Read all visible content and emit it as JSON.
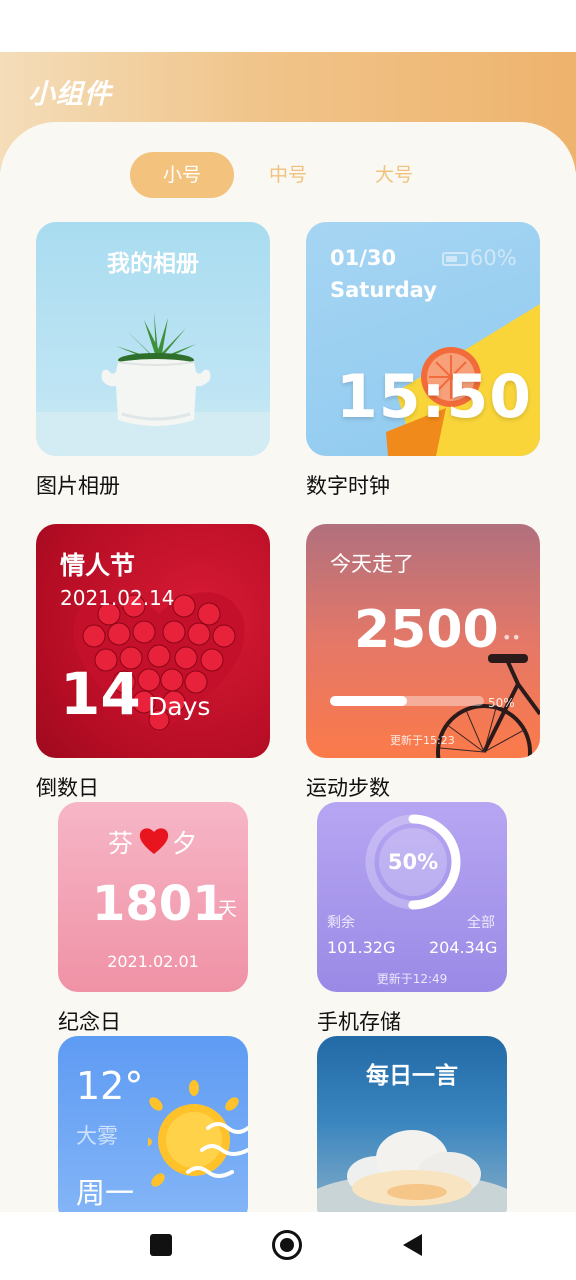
{
  "header": {
    "title": "小组件"
  },
  "tabs": [
    {
      "label": "小号",
      "active": true
    },
    {
      "label": "中号",
      "active": false
    },
    {
      "label": "大号",
      "active": false
    }
  ],
  "widgets": {
    "album": {
      "card_title": "我的相册",
      "caption": "图片相册"
    },
    "clock": {
      "date": "01/30",
      "weekday": "Saturday",
      "battery": "60%",
      "battery_level": 0.6,
      "time": "15:50",
      "caption": "数字时钟"
    },
    "countdown": {
      "event": "情人节",
      "date": "2021.02.14",
      "count": "14",
      "unit": "Days",
      "caption": "倒数日"
    },
    "steps": {
      "label": "今天走了",
      "count": "2500",
      "progress": "50%",
      "progress_value": 0.5,
      "updated": "更新于15:23",
      "caption": "运动步数"
    },
    "anniversary": {
      "name_left": "芬",
      "name_right": "夕",
      "days": "1801",
      "unit": "天",
      "date": "2021.02.01",
      "caption": "纪念日"
    },
    "storage": {
      "percent": "50%",
      "percent_value": 0.5,
      "remaining_label": "剩余",
      "total_label": "全部",
      "remaining": "101.32G",
      "total": "204.34G",
      "updated": "更新于12:49",
      "caption": "手机存储"
    },
    "weather": {
      "temp": "12°",
      "condition": "大雾",
      "day": "周一"
    },
    "quote": {
      "title": "每日一言"
    }
  },
  "colors": {
    "accent": "#f3c27c",
    "header_start": "#f4ddb9",
    "header_end": "#eeb36d",
    "background": "#faf8f3"
  },
  "nav": {
    "icons": [
      "recent-apps-icon",
      "home-icon",
      "back-icon"
    ]
  }
}
